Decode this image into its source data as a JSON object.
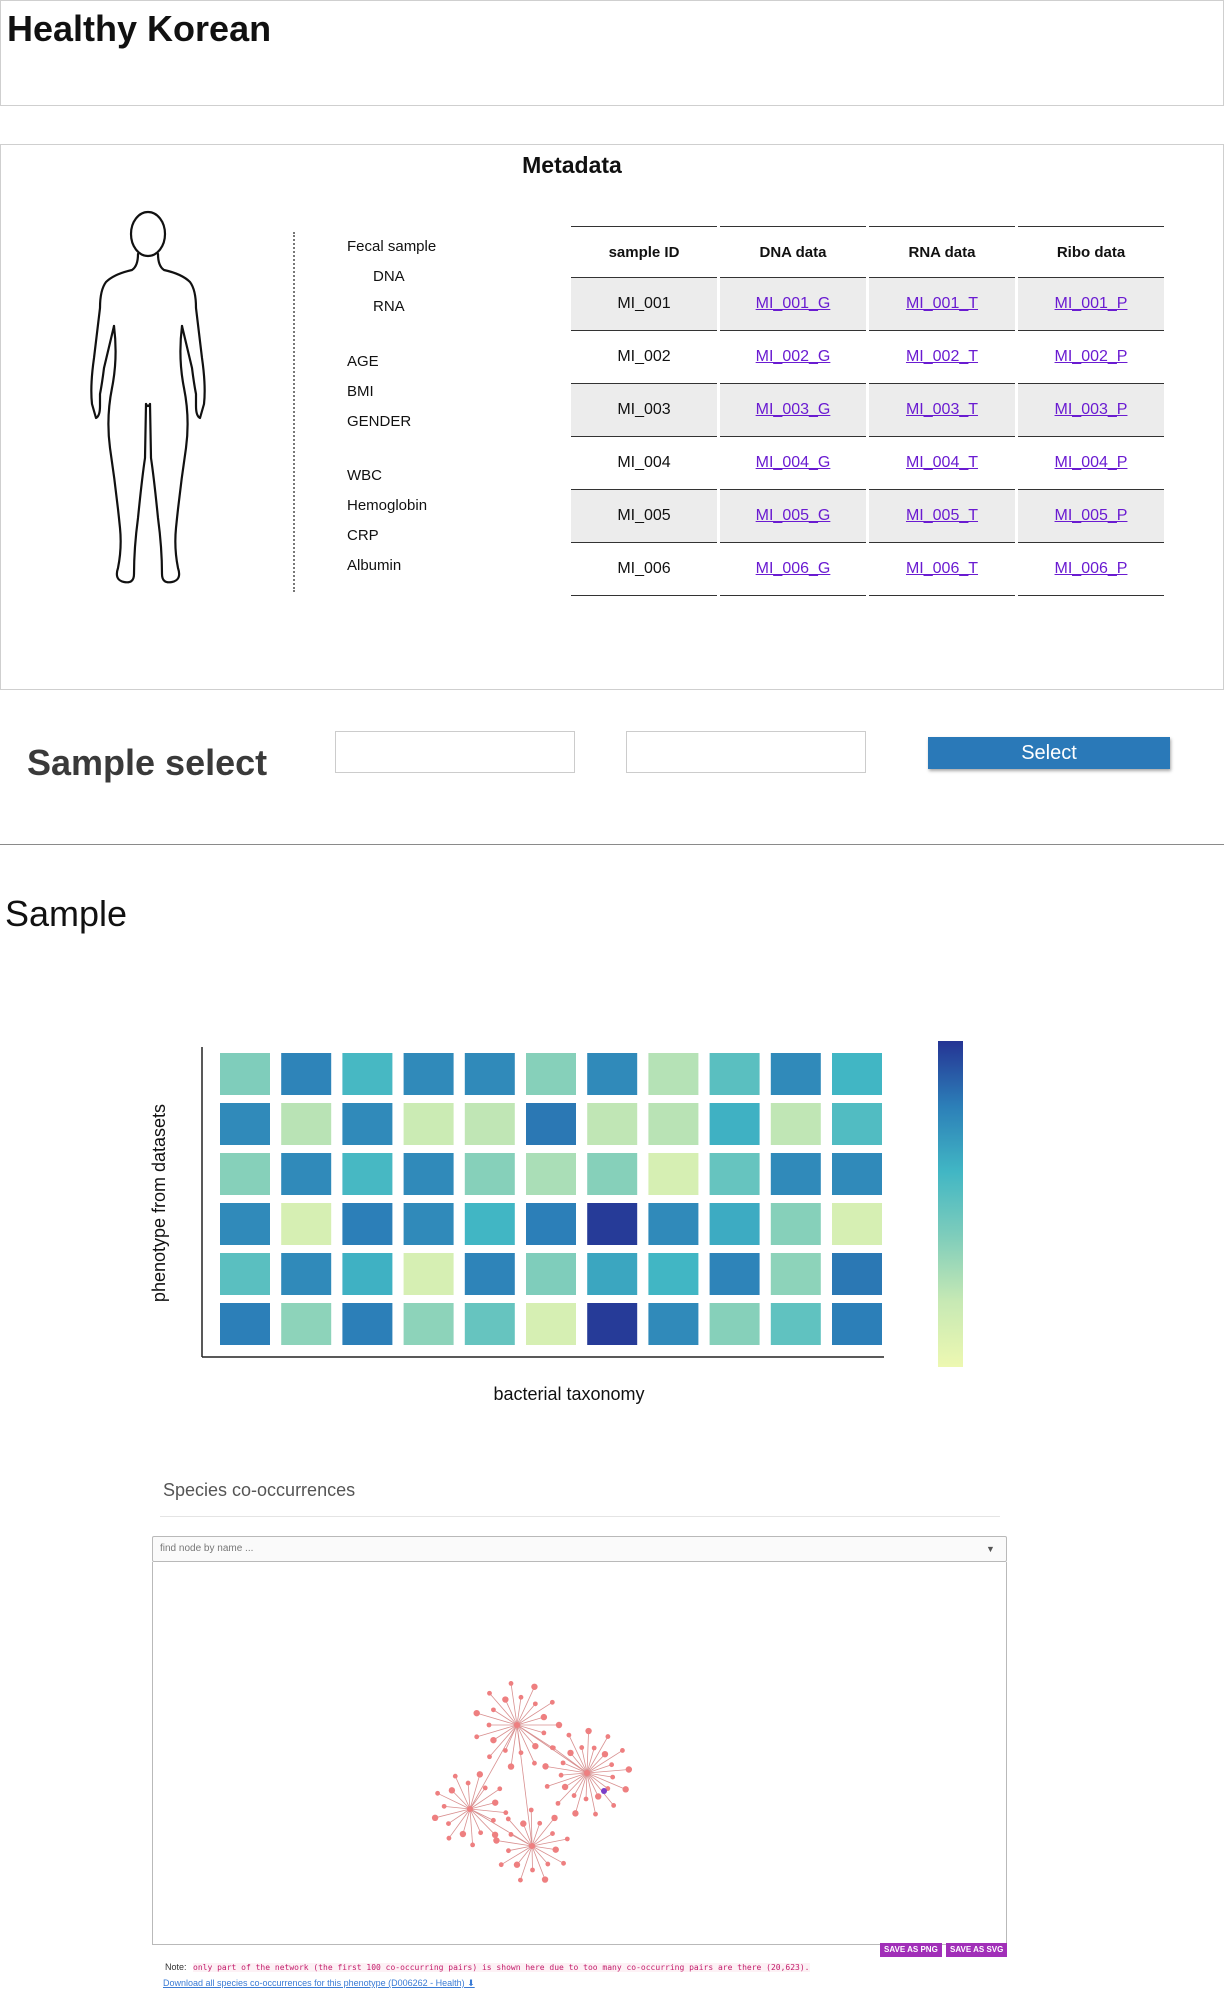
{
  "app": {
    "title": "Healthy Korean"
  },
  "metadata": {
    "title": "Metadata",
    "fields": [
      "Fecal sample",
      "DNA",
      "RNA",
      "AGE",
      "BMI",
      "GENDER",
      "WBC",
      "Hemoglobin",
      "CRP",
      "Albumin"
    ],
    "table": {
      "headers": [
        "sample ID",
        "DNA data",
        "RNA data",
        "Ribo data"
      ],
      "rows": [
        [
          "MI_001",
          "MI_001_G",
          "MI_001_T",
          "MI_001_P"
        ],
        [
          "MI_002",
          "MI_002_G",
          "MI_002_T",
          "MI_002_P"
        ],
        [
          "MI_003",
          "MI_003_G",
          "MI_003_T",
          "MI_003_P"
        ],
        [
          "MI_004",
          "MI_004_G",
          "MI_004_T",
          "MI_004_P"
        ],
        [
          "MI_005",
          "MI_005_G",
          "MI_005_T",
          "MI_005_P"
        ],
        [
          "MI_006",
          "MI_006_G",
          "MI_006_T",
          "MI_006_P"
        ]
      ]
    }
  },
  "sample_select": {
    "title": "Sample select",
    "input1_value": "",
    "input2_value": "",
    "button_label": "Select"
  },
  "sample": {
    "heading": "Sample"
  },
  "chart_data": {
    "type": "heatmap",
    "xlabel": "bacterial taxonomy",
    "ylabel": "phenotype from datasets",
    "rows": 6,
    "cols": 11,
    "values": [
      [
        0.4,
        0.78,
        0.58,
        0.76,
        0.76,
        0.38,
        0.76,
        0.25,
        0.52,
        0.76,
        0.6
      ],
      [
        0.76,
        0.24,
        0.76,
        0.18,
        0.22,
        0.82,
        0.22,
        0.24,
        0.62,
        0.22,
        0.55
      ],
      [
        0.38,
        0.76,
        0.58,
        0.76,
        0.38,
        0.28,
        0.38,
        0.12,
        0.48,
        0.76,
        0.76
      ],
      [
        0.76,
        0.12,
        0.8,
        0.76,
        0.6,
        0.8,
        0.98,
        0.76,
        0.64,
        0.38,
        0.12
      ],
      [
        0.52,
        0.76,
        0.62,
        0.12,
        0.78,
        0.4,
        0.66,
        0.6,
        0.78,
        0.36,
        0.82
      ],
      [
        0.8,
        0.36,
        0.8,
        0.36,
        0.48,
        0.12,
        0.98,
        0.76,
        0.38,
        0.5,
        0.8
      ]
    ],
    "colorscale": [
      "#edf8b1",
      "#c7e9b4",
      "#7fcdbb",
      "#41b6c4",
      "#2c7fb8",
      "#253494"
    ],
    "legend_placement": "right"
  },
  "network": {
    "title": "Species co-occurrences",
    "search_placeholder": "find node by name ...",
    "node_color": "#ee7f80",
    "highlight_node_color": "#7b3fc9",
    "save_png_label": "SAVE AS PNG",
    "save_svg_label": "SAVE AS SVG",
    "note_label": "Note:",
    "note_text": "only part of the network (the first 100 co-occurring pairs) is shown here due to too many co-occurring pairs are there (20,623).",
    "download_text": "Download all species co-occurrences for this phenotype (D006262 - Health) ⬇"
  }
}
